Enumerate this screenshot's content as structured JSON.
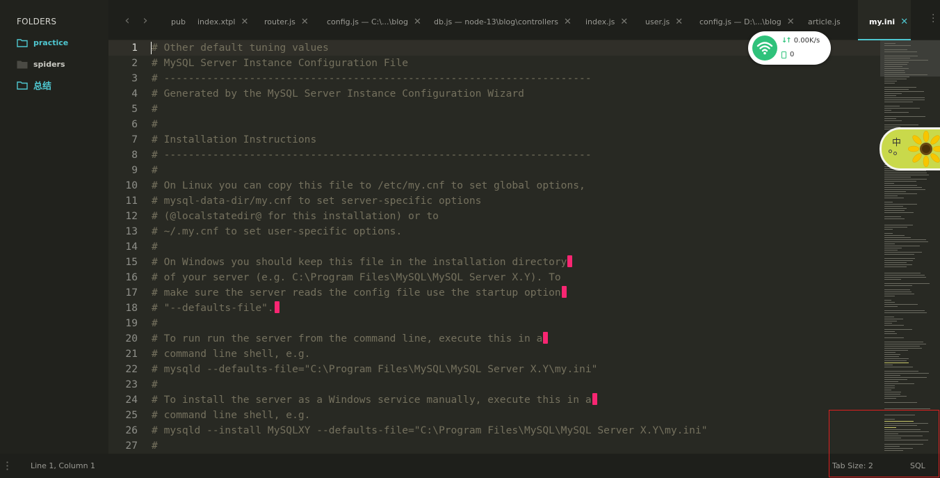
{
  "sidebar": {
    "title": "FOLDERS",
    "folders": [
      {
        "label": "practice",
        "state": "open"
      },
      {
        "label": "spiders",
        "state": "closed"
      },
      {
        "label": "总结",
        "state": "open"
      }
    ]
  },
  "tabs": [
    {
      "label": "pub",
      "closable": false
    },
    {
      "label": "index.xtpl",
      "closable": true
    },
    {
      "label": "router.js",
      "closable": true
    },
    {
      "label": "config.js — C:\\...\\blog",
      "closable": true
    },
    {
      "label": "db.js — node-13\\blog\\controllers",
      "closable": true
    },
    {
      "label": "index.js",
      "closable": true
    },
    {
      "label": "user.js",
      "closable": true
    },
    {
      "label": "config.js — D:\\...\\blog",
      "closable": true
    },
    {
      "label": "article.js",
      "closable": false
    },
    {
      "label": "my.ini",
      "closable": true,
      "active": true
    }
  ],
  "tab_close_glyph": "✕",
  "nav": {
    "back": "‹",
    "forward": "›"
  },
  "editor": {
    "lines": [
      {
        "n": "1",
        "text": "# Other default tuning values"
      },
      {
        "n": "2",
        "text": "# MySQL Server Instance Configuration File"
      },
      {
        "n": "3",
        "text": "# ----------------------------------------------------------------------"
      },
      {
        "n": "4",
        "text": "# Generated by the MySQL Server Instance Configuration Wizard"
      },
      {
        "n": "5",
        "text": "#"
      },
      {
        "n": "6",
        "text": "#"
      },
      {
        "n": "7",
        "text": "# Installation Instructions"
      },
      {
        "n": "8",
        "text": "# ----------------------------------------------------------------------"
      },
      {
        "n": "9",
        "text": "#"
      },
      {
        "n": "10",
        "text": "# On Linux you can copy this file to /etc/my.cnf to set global options,"
      },
      {
        "n": "11",
        "text": "# mysql-data-dir/my.cnf to set server-specific options"
      },
      {
        "n": "12",
        "text": "# (@localstatedir@ for this installation) or to"
      },
      {
        "n": "13",
        "text": "# ~/.my.cnf to set user-specific options."
      },
      {
        "n": "14",
        "text": "#"
      },
      {
        "n": "15",
        "text": "# On Windows you should keep this file in the installation directory",
        "trailing": true
      },
      {
        "n": "16",
        "text": "# of your server (e.g. C:\\Program Files\\MySQL\\MySQL Server X.Y). To"
      },
      {
        "n": "17",
        "text": "# make sure the server reads the config file use the startup option",
        "trailing": true
      },
      {
        "n": "18",
        "text": "# \"--defaults-file\".",
        "trailing": true
      },
      {
        "n": "19",
        "text": "#"
      },
      {
        "n": "20",
        "text": "# To run run the server from the command line, execute this in a",
        "trailing": true
      },
      {
        "n": "21",
        "text": "# command line shell, e.g."
      },
      {
        "n": "22",
        "text": "# mysqld --defaults-file=\"C:\\Program Files\\MySQL\\MySQL Server X.Y\\my.ini\""
      },
      {
        "n": "23",
        "text": "#"
      },
      {
        "n": "24",
        "text": "# To install the server as a Windows service manually, execute this in a",
        "trailing": true
      },
      {
        "n": "25",
        "text": "# command line shell, e.g."
      },
      {
        "n": "26",
        "text": "# mysqld --install MySQLXY --defaults-file=\"C:\\Program Files\\MySQL\\MySQL Server X.Y\\my.ini\""
      },
      {
        "n": "27",
        "text": "#"
      }
    ]
  },
  "net_widget": {
    "speed": "0.00K/s",
    "count": "0"
  },
  "ime_widget": {
    "mode": "中"
  },
  "statusbar": {
    "position": "Line 1, Column 1",
    "tab_size": "Tab Size: 2",
    "syntax": "SQL"
  },
  "colors": {
    "accent": "#4fc7d0",
    "comment": "#75715e",
    "trailing_whitespace": "#f92672",
    "background": "#282923"
  }
}
